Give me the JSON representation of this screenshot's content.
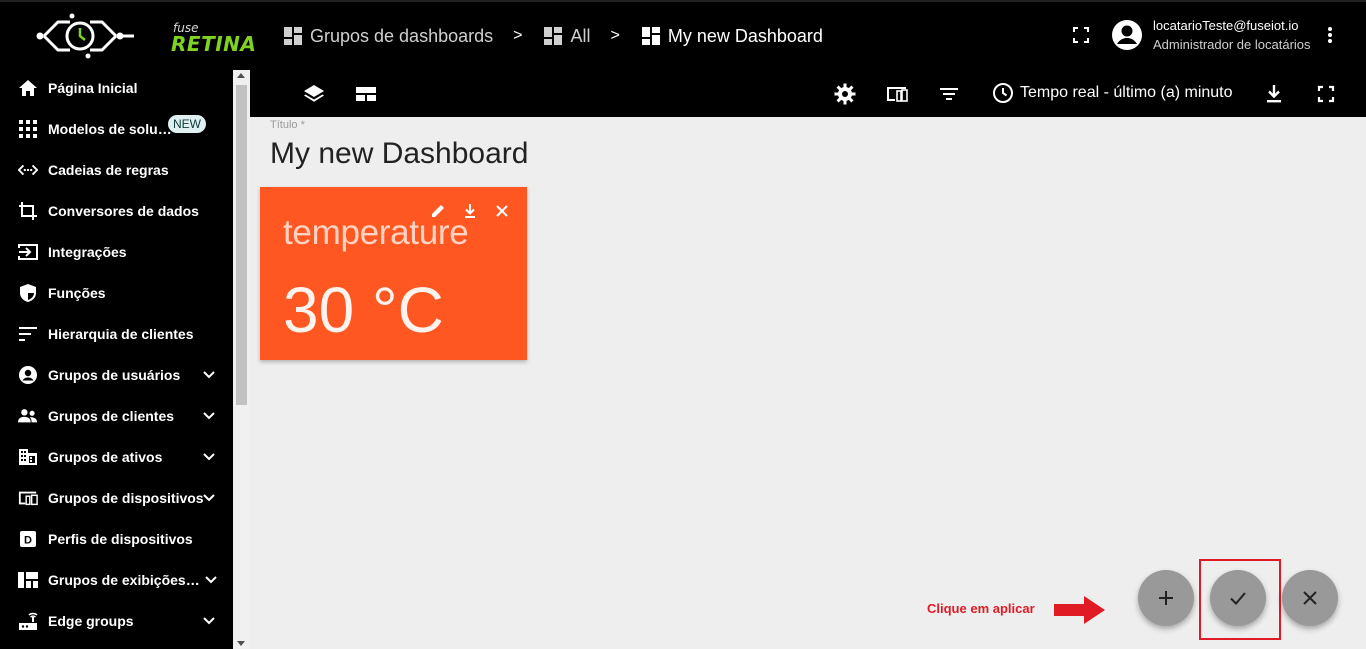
{
  "brand": {
    "small": "fuse",
    "big": "RETINA",
    "accent": "#7ed321"
  },
  "breadcrumb": [
    {
      "label": "Grupos de dashboards"
    },
    {
      "label": "All"
    },
    {
      "label": "My new Dashboard"
    }
  ],
  "breadcrumb_separator": ">",
  "user": {
    "email": "locatarioTeste@fuseiot.io",
    "role": "Administrador de locatários"
  },
  "sidebar": {
    "items": [
      {
        "label": "Página Inicial",
        "icon": "home-icon",
        "expandable": false
      },
      {
        "label": "Modelos de solução",
        "icon": "apps-icon",
        "expandable": false,
        "badge": "NEW"
      },
      {
        "label": "Cadeias de regras",
        "icon": "settings-ethernet-icon",
        "expandable": false
      },
      {
        "label": "Conversores de dados",
        "icon": "transform-icon",
        "expandable": false
      },
      {
        "label": "Integrações",
        "icon": "input-icon",
        "expandable": false
      },
      {
        "label": "Funções",
        "icon": "security-icon",
        "expandable": false
      },
      {
        "label": "Hierarquia de clientes",
        "icon": "sort-icon",
        "expandable": false
      },
      {
        "label": "Grupos de usuários",
        "icon": "account-circle-icon",
        "expandable": true
      },
      {
        "label": "Grupos de clientes",
        "icon": "supervisor-account-icon",
        "expandable": true
      },
      {
        "label": "Grupos de ativos",
        "icon": "domain-icon",
        "expandable": true
      },
      {
        "label": "Grupos de dispositivos",
        "icon": "devices-other-icon",
        "expandable": true
      },
      {
        "label": "Perfis de dispositivos",
        "icon": "device-profile-icon",
        "expandable": false
      },
      {
        "label": "Grupos de exibições de entidades",
        "icon": "view-quilt-icon",
        "expandable": true
      },
      {
        "label": "Edge groups",
        "icon": "router-icon",
        "expandable": true
      }
    ]
  },
  "toolbar": {
    "timewindow_label": "Tempo real - último (a) minuto"
  },
  "dashboard": {
    "title_label": "Título *",
    "title": "My new Dashboard"
  },
  "widget": {
    "title": "temperature",
    "value": "30 °C",
    "color": "#ff5722"
  },
  "annotation": {
    "text": "Clique em aplicar",
    "color": "#e01b24"
  }
}
